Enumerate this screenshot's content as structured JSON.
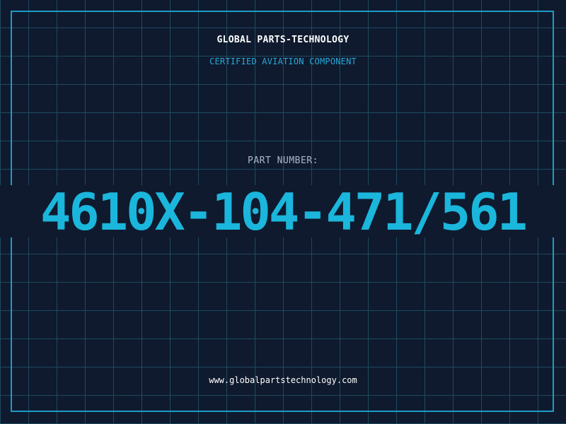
{
  "header": {
    "company": "GLOBAL PARTS-TECHNOLOGY",
    "subtitle": "CERTIFIED AVIATION COMPONENT"
  },
  "part": {
    "label": "PART NUMBER:",
    "number": "4610X-104-471/561"
  },
  "footer": {
    "website": "www.globalpartstechnology.com"
  },
  "colors": {
    "background": "#0f1a2e",
    "grid": "#1e4a5e",
    "frame": "#1e9cc4",
    "accent": "#1bb6dc",
    "subtitle": "#28a8d8"
  }
}
